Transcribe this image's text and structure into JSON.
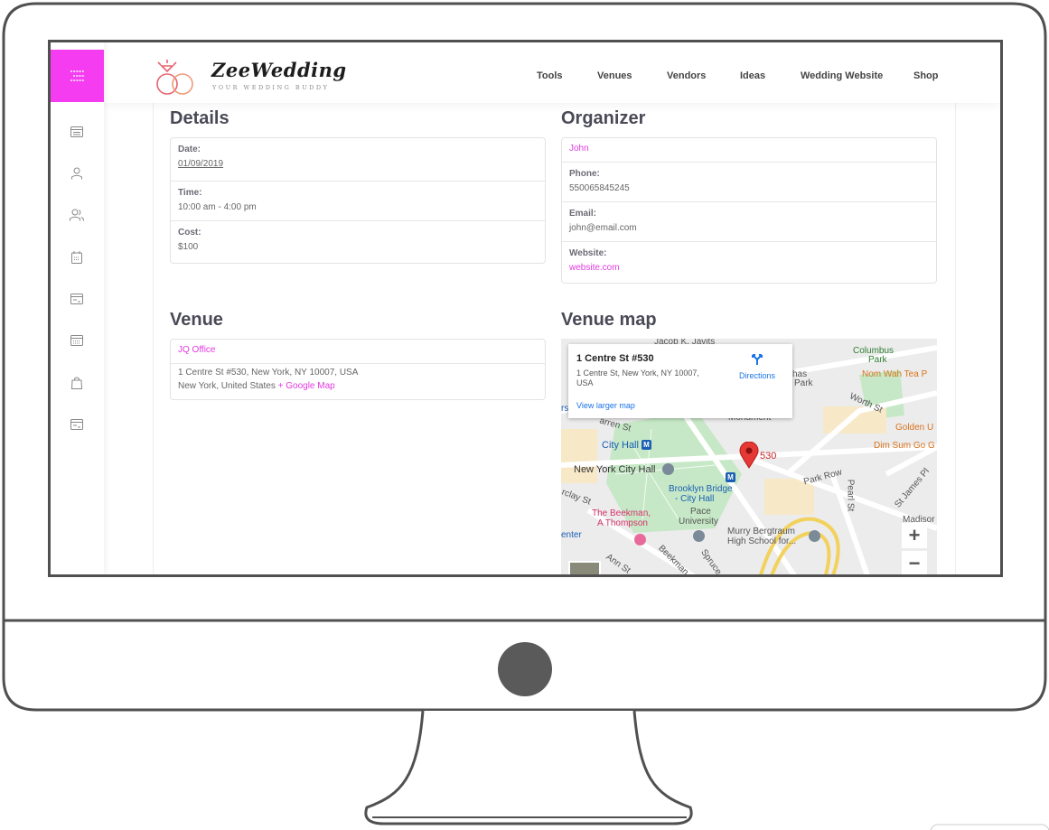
{
  "app": {
    "brand_name": "ZeeWedding",
    "tagline": "YOUR WEDDING BUDDY",
    "accent_color": "#f53cf0"
  },
  "nav": {
    "items": [
      "Tools",
      "Venues",
      "Vendors",
      "Ideas",
      "Wedding Website",
      "Shop"
    ]
  },
  "sidebar": {
    "icons": [
      "menu-icon",
      "dashboard-icon",
      "user-icon",
      "users-icon",
      "calendar-icon",
      "budget-icon",
      "checklist-icon",
      "shopping-bag-icon",
      "card-icon"
    ]
  },
  "details": {
    "title": "Details",
    "date_label": "Date:",
    "date_value": "01/09/2019",
    "time_label": "Time:",
    "time_value": "10:00 am - 4:00 pm",
    "cost_label": "Cost:",
    "cost_value": "$100"
  },
  "organizer": {
    "title": "Organizer",
    "name": "John",
    "phone_label": "Phone:",
    "phone_value": "550065845245",
    "email_label": "Email:",
    "email_value": "john@email.com",
    "website_label": "Website:",
    "website_value": "website.com"
  },
  "venue": {
    "title": "Venue",
    "name": "JQ Office",
    "address_line1": "1 Centre St #530, New York, NY 10007, USA",
    "address_line2": "New York, United States",
    "map_link": "+ Google Map"
  },
  "venue_map": {
    "title": "Venue map",
    "info_title": "1 Centre St #530",
    "info_address_line1": "1 Centre St, New York, NY 10007,",
    "info_address_line2": "USA",
    "directions_label": "Directions",
    "larger_map_label": "View larger map",
    "marker_label": "530",
    "zoom_in": "+",
    "zoom_out": "−",
    "labels": {
      "javits": "Jacob K. Javits",
      "columbus": "Columbus",
      "park": "Park",
      "nom_wah": "Nom Wah Tea P",
      "has": "has",
      "park2": "Park",
      "worth": "Worth St",
      "golden": "Golden U",
      "monument": "Monument",
      "warren": "arren St",
      "city_hall": "City Hall",
      "dim_sum": "Dim Sum Go G",
      "nyc_hall": "New York City Hall",
      "park_row": "Park Row",
      "pearl": "Pearl St",
      "james": "St James Pl",
      "brooklyn1": "Brooklyn Bridge",
      "brooklyn2": "- City Hall",
      "rs": "rs",
      "barclay": "rclay St",
      "beekman1": "The Beekman,",
      "beekman2": "A Thompson",
      "pace1": "Pace",
      "pace2": "University",
      "center": "enter",
      "murry1": "Murry Bergtraum",
      "murry2": "High School for...",
      "ann": "Ann St",
      "beekman_st": "Beekman",
      "spruce": "Spruce",
      "madison": "Madisor"
    }
  }
}
